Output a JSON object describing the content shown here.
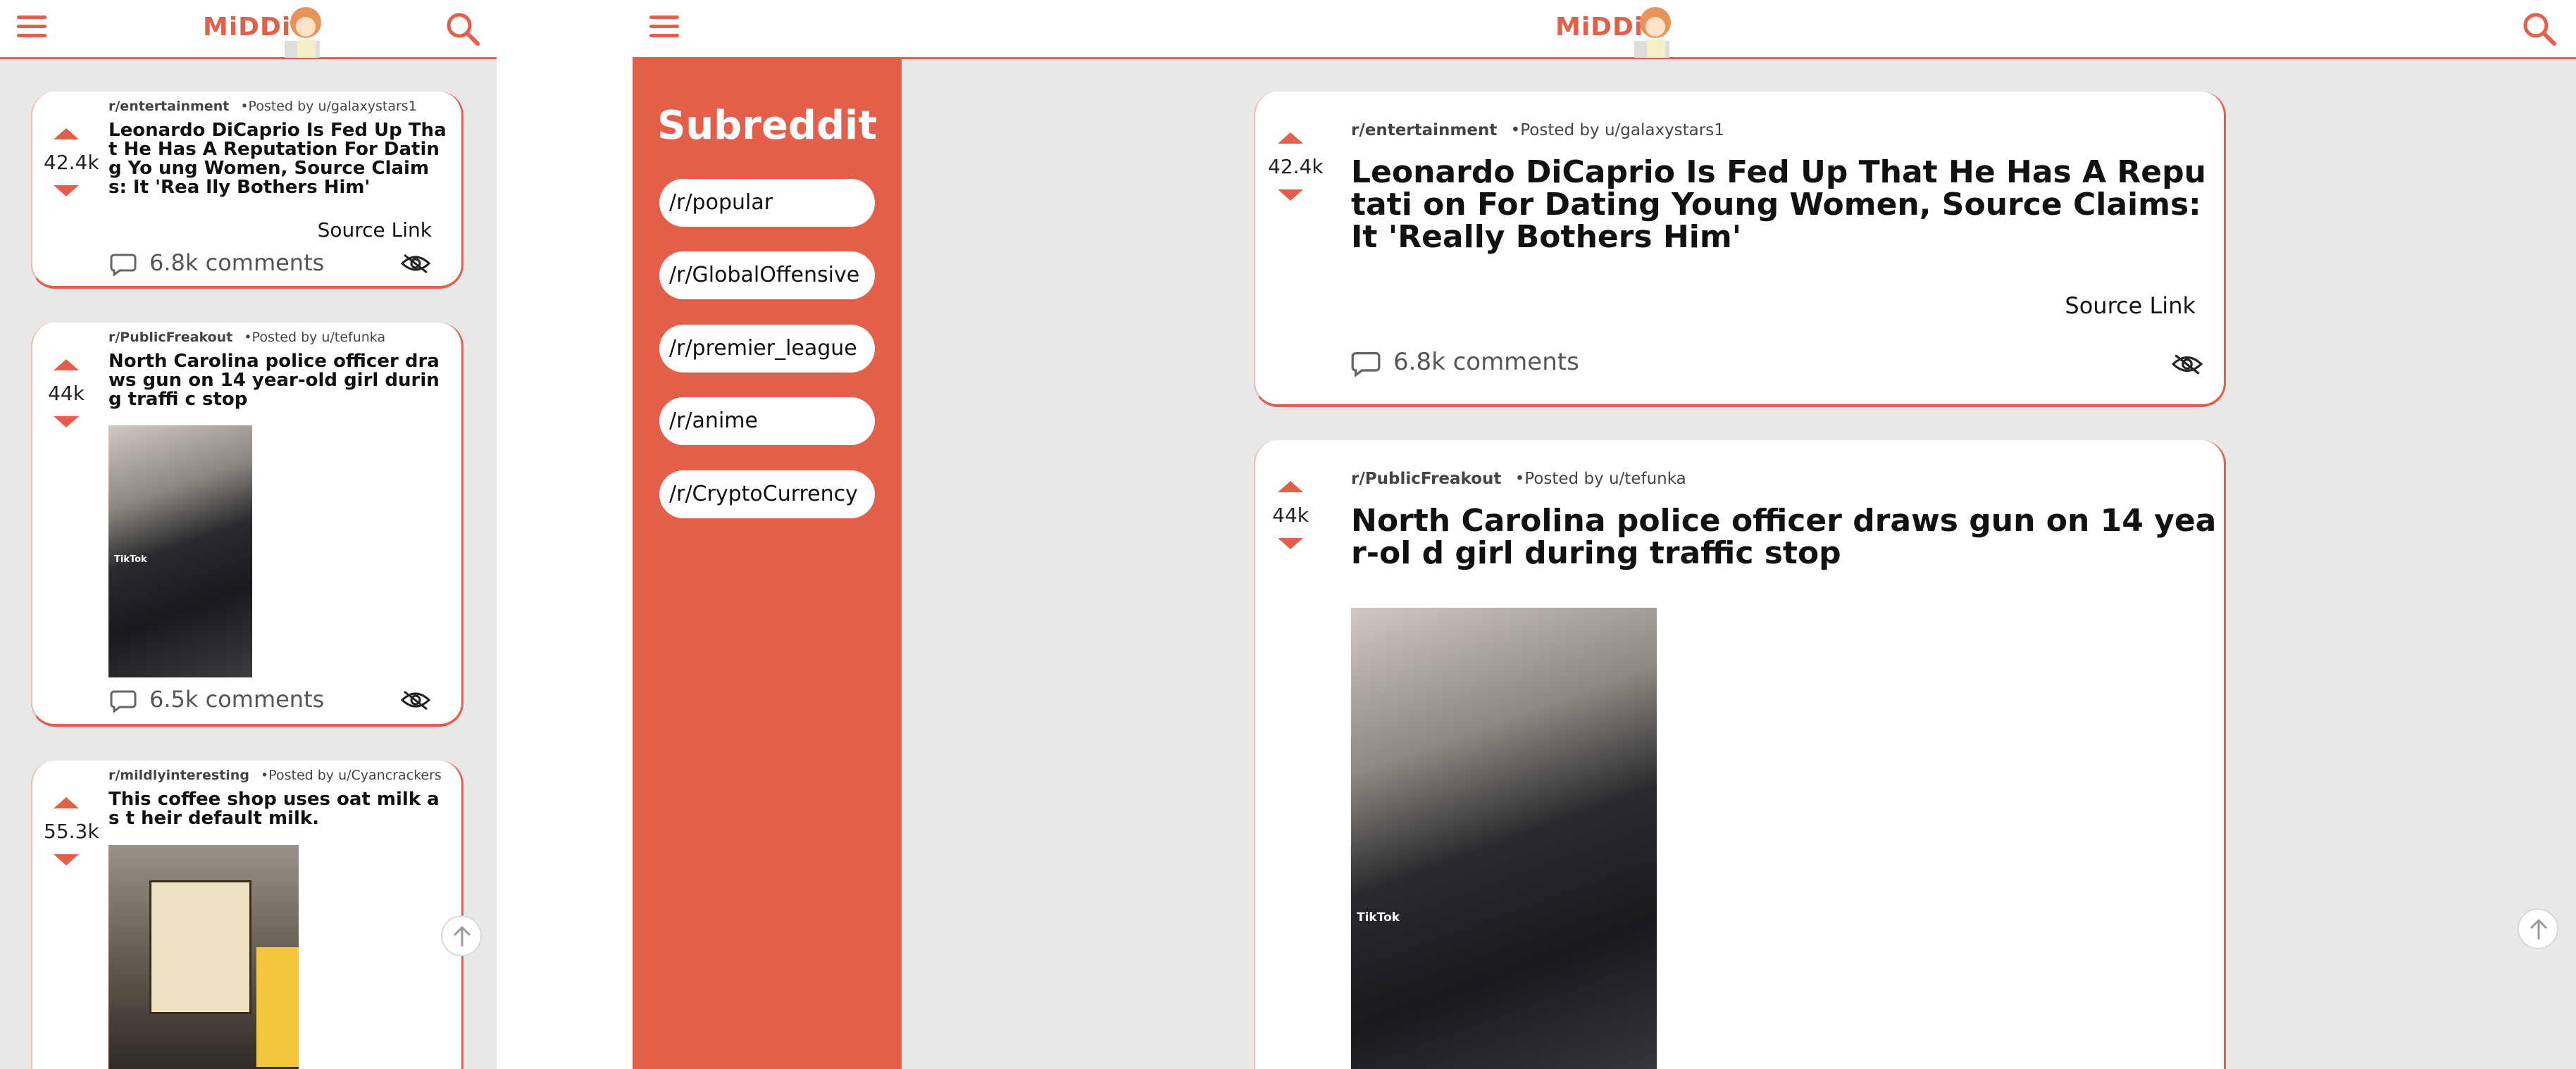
{
  "app": {
    "logo_text": "MiDDiT"
  },
  "accent_color": "#e45f4a",
  "icons": {
    "menu": "hamburger-icon",
    "search": "search-icon",
    "comment": "comment-bubble-icon",
    "hide": "eye-slash-icon",
    "scroll_top": "arrow-up-icon"
  },
  "sidebar": {
    "title": "Subreddit",
    "items": [
      {
        "label": "/r/popular"
      },
      {
        "label": "/r/GlobalOffensive"
      },
      {
        "label": "/r/premier_league"
      },
      {
        "label": "/r/anime"
      },
      {
        "label": "/r/CryptoCurrency"
      }
    ]
  },
  "posts": [
    {
      "subreddit": "r/entertainment",
      "posted_by": "•Posted by u/galaxystars1",
      "score": "42.4k",
      "title_mobile": "Leonardo DiCaprio Is Fed Up That He Has A Reputation For Dating Yo ung Women, Source Claims: It 'Rea lly Bothers Him'",
      "title_desktop": "Leonardo DiCaprio Is Fed Up That He Has A Reputati on For Dating Young Women, Source Claims: It 'Really Bothers Him'",
      "source_label": "Source Link",
      "comments": "6.8k comments"
    },
    {
      "subreddit": "r/PublicFreakout",
      "posted_by": "•Posted by u/tefunka",
      "score": "44k",
      "title_mobile": "North Carolina police officer draws gun on 14 year-old girl during traffi c stop",
      "title_desktop": "North Carolina police officer draws gun on 14 year-ol d girl during traffic stop",
      "media_label": "TikTok",
      "comments": "6.5k comments"
    },
    {
      "subreddit": "r/mildlyinteresting",
      "posted_by": "•Posted by u/Cyancrackers",
      "score": "55.3k",
      "title_mobile": "This coffee shop uses oat milk as t heir default milk."
    }
  ]
}
